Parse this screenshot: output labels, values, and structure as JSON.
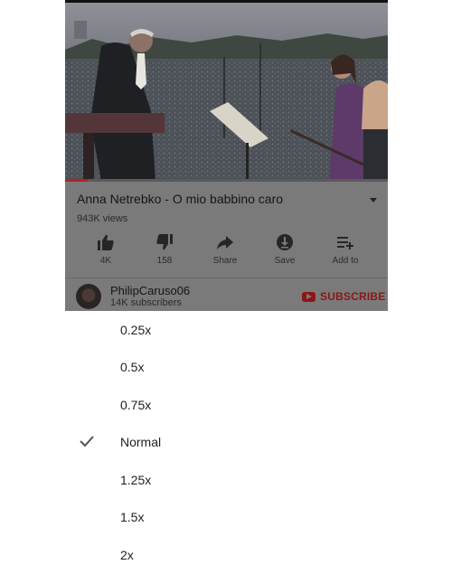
{
  "video": {
    "title": "Anna Netrebko - O mio babbino caro",
    "views": "943K views",
    "progress_fraction": 0.07
  },
  "actions": [
    {
      "icon": "thumbs-up-icon",
      "label": "4K"
    },
    {
      "icon": "thumbs-down-icon",
      "label": "158"
    },
    {
      "icon": "share-icon",
      "label": "Share"
    },
    {
      "icon": "download-icon",
      "label": "Save"
    },
    {
      "icon": "add-to-playlist-icon",
      "label": "Add to"
    }
  ],
  "channel": {
    "name": "PhilipCaruso06",
    "subscribers": "14K subscribers",
    "subscribe_label": "SUBSCRIBE"
  },
  "speed_menu": {
    "options": [
      "0.25x",
      "0.5x",
      "0.75x",
      "Normal",
      "1.25x",
      "1.5x",
      "2x"
    ],
    "selected": "Normal"
  },
  "colors": {
    "overlay_dim": "#7a7a7a",
    "subscribe_red": "#8e1515",
    "menu_bg": "#ffffff"
  }
}
